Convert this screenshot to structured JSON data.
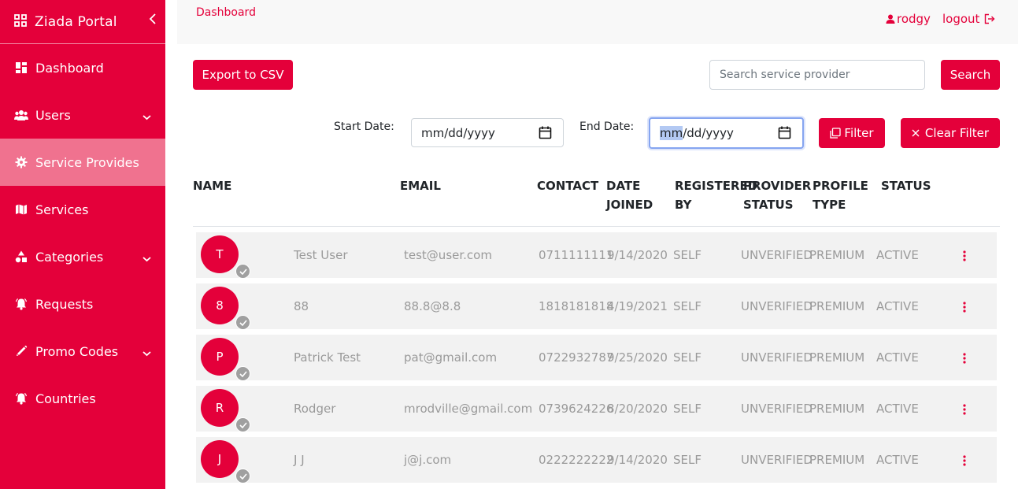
{
  "sidebar": {
    "brand": "Ziada Portal",
    "items": [
      {
        "label": "Dashboard"
      },
      {
        "label": "Users"
      },
      {
        "label": "Service Provides"
      },
      {
        "label": "Services"
      },
      {
        "label": "Categories"
      },
      {
        "label": "Requests"
      },
      {
        "label": "Promo Codes"
      },
      {
        "label": "Countries"
      }
    ]
  },
  "header": {
    "breadcrumb": "Dashboard",
    "username": "rodgy",
    "logout": "logout"
  },
  "toolbar": {
    "export_label": "Export to CSV",
    "search_placeholder": "Search service provider",
    "search_label": "Search",
    "start_date_label": "Start Date:",
    "end_date_label": "End Date:",
    "date_mm": "mm",
    "date_rest": "/dd/yyyy",
    "start_date_value": "mm/dd/yyyy",
    "filter_label": "Filter",
    "clear_filter_label": "Clear Filter"
  },
  "table": {
    "headers": {
      "name": "NAME",
      "email": "EMAIL",
      "contact": "CONTACT",
      "date1": "DATE",
      "date2": "JOINED",
      "reg1": "REGISTERED",
      "reg2": "BY",
      "prov1": "PROVIDER",
      "prov2": "STATUS",
      "prof1": "PROFILE",
      "prof2": "TYPE",
      "status": "STATUS"
    },
    "rows": [
      {
        "initial": "T",
        "name": "Test User",
        "email": "test@user.com",
        "contact": "0711111111",
        "date": "9/14/2020",
        "registered_by": "SELF",
        "provider_status": "UNVERIFIED",
        "profile_type": "PREMIUM",
        "status": "ACTIVE"
      },
      {
        "initial": "8",
        "name": "88",
        "email": "88.8@8.8",
        "contact": "1818181818",
        "date": "4/19/2021",
        "registered_by": "SELF",
        "provider_status": "UNVERIFIED",
        "profile_type": "PREMIUM",
        "status": "ACTIVE"
      },
      {
        "initial": "P",
        "name": "Patrick Test",
        "email": "pat@gmail.com",
        "contact": "0722932787",
        "date": "9/25/2020",
        "registered_by": "SELF",
        "provider_status": "UNVERIFIED",
        "profile_type": "PREMIUM",
        "status": "ACTIVE"
      },
      {
        "initial": "R",
        "name": "Rodger",
        "email": "mrodville@gmail.com",
        "contact": "0739624226",
        "date": "8/20/2020",
        "registered_by": "SELF",
        "provider_status": "UNVERIFIED",
        "profile_type": "PREMIUM",
        "status": "ACTIVE"
      },
      {
        "initial": "J",
        "name": "J J",
        "email": "j@j.com",
        "contact": "0222222222",
        "date": "9/14/2020",
        "registered_by": "SELF",
        "provider_status": "UNVERIFIED",
        "profile_type": "PREMIUM",
        "status": "ACTIVE"
      }
    ]
  },
  "icons": {
    "brand": "grid-icon",
    "dashboard": "dashboard-icon",
    "users": "users-icon",
    "service_provides": "gear-icon",
    "services": "map-icon",
    "categories": "shapes-icon",
    "requests": "bell-icon",
    "promo_codes": "pencil-icon",
    "countries": "bell-icon",
    "user": "user-icon",
    "logout": "logout-icon",
    "filter": "filter-icon",
    "clear": "close-icon",
    "row_menu": "kebab-icon",
    "verified": "check-icon"
  },
  "colors": {
    "brand": "#e4003a",
    "active_nav": "#f0728f",
    "row_bg": "#f2f2f2",
    "row_text": "#9a9a9a"
  }
}
